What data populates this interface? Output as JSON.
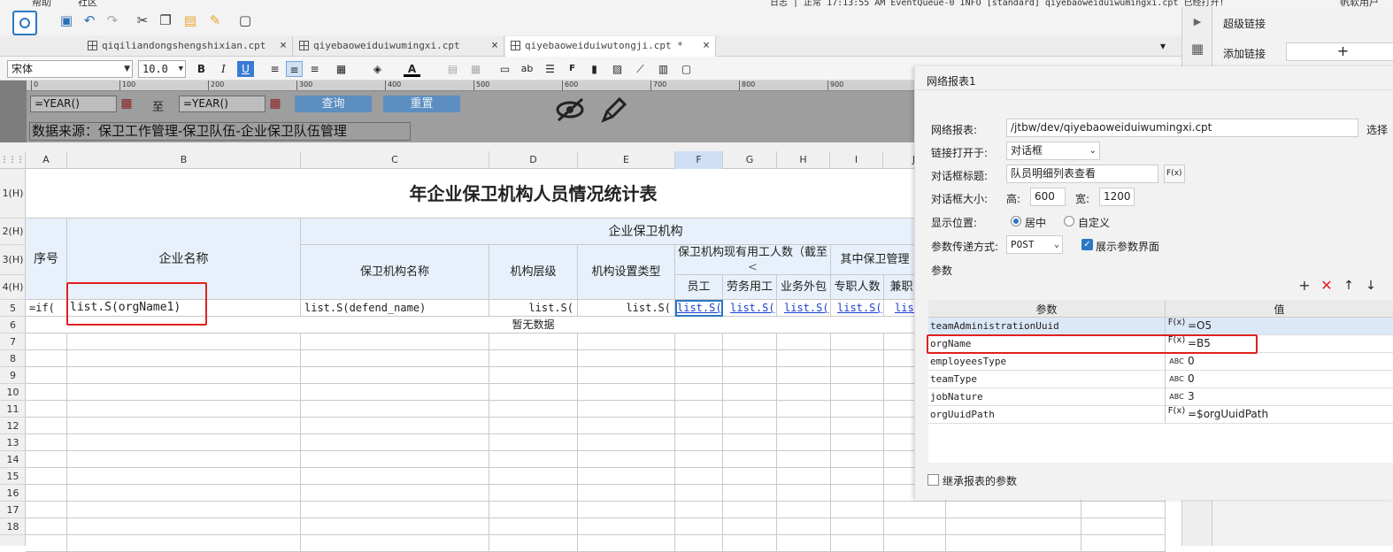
{
  "menu": {
    "item1": "帮助",
    "item2": "社区",
    "status": "日志  | 正常 17:13:55 AM EventQueue-0 INFO [standard] qiyebaoweiduiwumingxi.cpt 已经打开!",
    "user": "帆软用户"
  },
  "tabs": [
    {
      "label": "qiqiliandongshengshixian.cpt",
      "close": "×"
    },
    {
      "label": "qiyebaoweiduiwumingxi.cpt",
      "close": "×"
    },
    {
      "label": "qiyebaoweiduiwutongji.cpt *",
      "close": "×"
    }
  ],
  "format": {
    "font": "宋体",
    "size": "10.0",
    "bold": "B",
    "italic": "I",
    "underline": "U"
  },
  "params": {
    "year_from": "=YEAR()",
    "to_label": "至",
    "year_to": "=YEAR()",
    "query_btn": "查询",
    "reset_btn": "重置",
    "source": "数据来源：保卫工作管理-保卫队伍-企业保卫队伍管理"
  },
  "ruler": [
    "0",
    "100",
    "200",
    "300",
    "400",
    "500",
    "600",
    "700",
    "800",
    "900"
  ],
  "columns": [
    "A",
    "B",
    "C",
    "D",
    "E",
    "F",
    "G",
    "H",
    "I",
    "J"
  ],
  "rows": [
    "1(H)",
    "2(H)",
    "3(H)",
    "4(H)",
    "5",
    "6",
    "7",
    "8",
    "9",
    "10",
    "11",
    "12",
    "13",
    "14",
    "15",
    "16",
    "17",
    "18"
  ],
  "sheet": {
    "title": "年企业保卫机构人员情况统计表",
    "seq": "序号",
    "company": "企业名称",
    "group": "企业保卫机构",
    "org_name": "保卫机构名称",
    "level": "机构层级",
    "setup_type": "机构设置类型",
    "staff_group": "保卫机构现有用工人数（截至",
    "arrow": "<",
    "sub_group": "其中保卫管理",
    "staff": "员工",
    "labor": "劳务用工",
    "outsourced": "业务外包",
    "fulltime": "专职人数",
    "parttime": "兼职",
    "r5": {
      "a": "=if(",
      "b": "list.S(orgName1)",
      "c": "list.S(defend_name)",
      "d": "list.S(",
      "e": "list.S(",
      "f": "list.S(",
      "g": "list.S(",
      "h": "list.S(",
      "i": "list.S(",
      "j": "list"
    },
    "nodata": "暂无数据"
  },
  "right_panel": {
    "hyperlink": "超级链接",
    "add_link": "添加链接",
    "add_icon": "+"
  },
  "dialog": {
    "title": "网络报表1",
    "report_label": "网络报表:",
    "report_value": "/jtbw/dev/qiyebaoweiduiwumingxi.cpt",
    "choose": "选择",
    "open_in_label": "链接打开于:",
    "open_in_value": "对话框",
    "dlg_title_label": "对话框标题:",
    "dlg_title_value": "队员明细列表查看",
    "fx": "F(x)",
    "size_label": "对话框大小:",
    "height_label": "高:",
    "height_value": "600",
    "width_label": "宽:",
    "width_value": "1200",
    "position_label": "显示位置:",
    "pos_center": "居中",
    "pos_custom": "自定义",
    "method_label": "参数传递方式:",
    "method_value": "POST",
    "show_params": "展示参数界面",
    "params_section": "参数",
    "col_param": "参数",
    "col_value": "值",
    "param_rows": [
      {
        "name": "teamAdministrationUuid",
        "type": "F(x)",
        "value": "=O5"
      },
      {
        "name": "orgName",
        "type": "F(x)",
        "value": "=B5"
      },
      {
        "name": "employeesType",
        "type": "ABC",
        "value": "0"
      },
      {
        "name": "teamType",
        "type": "ABC",
        "value": "0"
      },
      {
        "name": "jobNature",
        "type": "ABC",
        "value": "3"
      },
      {
        "name": "orgUuidPath",
        "type": "F(x)",
        "value": "=$orgUuidPath"
      }
    ],
    "inherit": "继承报表的参数"
  }
}
